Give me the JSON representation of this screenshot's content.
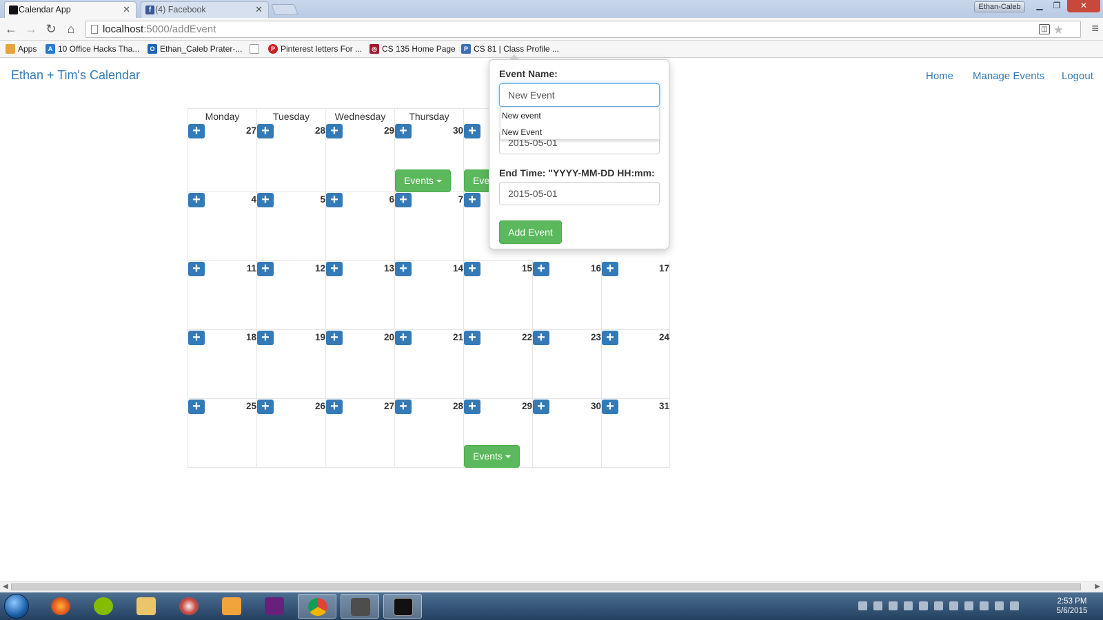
{
  "browser": {
    "tabs": [
      {
        "title": "Calendar App"
      },
      {
        "title": "(4) Facebook"
      }
    ],
    "tab_close_glyph": "✕",
    "profile_name": "Ethan-Caleb",
    "url_host": "localhost",
    "url_path": ":5000/addEvent",
    "bookmarks": [
      "Apps",
      "10 Office Hacks Tha...",
      "Ethan_Caleb Prater-...",
      "",
      "Pinterest letters For ...",
      "CS 135 Home Page",
      "CS 81 | Class Profile ..."
    ]
  },
  "app": {
    "brand": "Ethan + Tim's Calendar",
    "nav": [
      "Home",
      "Manage Events",
      "Logout"
    ]
  },
  "calendar": {
    "day_headers": [
      "Monday",
      "Tuesday",
      "Wednesday",
      "Thursday",
      "F"
    ],
    "add_glyph": "+",
    "weeks": [
      [
        "27",
        "28",
        "29",
        "30",
        "",
        "",
        ""
      ],
      [
        "4",
        "5",
        "6",
        "7",
        "",
        "",
        ""
      ],
      [
        "11",
        "12",
        "13",
        "14",
        "15",
        "16",
        "17"
      ],
      [
        "18",
        "19",
        "20",
        "21",
        "22",
        "23",
        "24"
      ],
      [
        "25",
        "26",
        "27",
        "28",
        "29",
        "30",
        "31"
      ]
    ],
    "events_label": "Events",
    "events_label_clipped": "Eve"
  },
  "form": {
    "event_name_label": "Event Name:",
    "event_name_value": "New Event",
    "autocomplete": [
      "New event",
      "New Event"
    ],
    "start_time_value": "2015-05-01",
    "end_time_label": "End Time: \"YYYY-MM-DD HH:mm:",
    "end_time_value": "2015-05-01",
    "submit_label": "Add Event"
  },
  "taskbar": {
    "time": "2:53 PM",
    "date": "5/6/2015"
  },
  "colors": {
    "link": "#337ab7",
    "primary_button": "#337ab7",
    "success_button": "#5cb85c"
  }
}
